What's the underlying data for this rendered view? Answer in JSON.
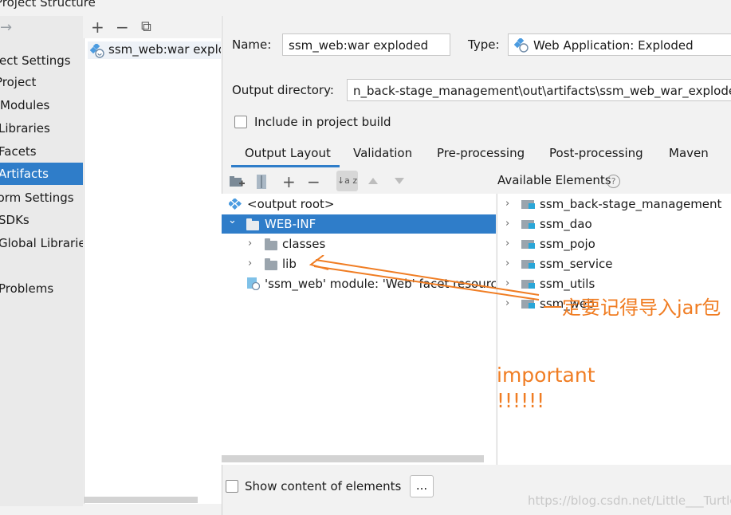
{
  "window": {
    "title": "Project Structure"
  },
  "nav": {
    "back_arrow": "→",
    "items": [
      {
        "label": "Project Settings",
        "selected": false
      },
      {
        "label": "Project",
        "selected": false
      },
      {
        "label": "Modules",
        "selected": false
      },
      {
        "label": "Libraries",
        "selected": false
      },
      {
        "label": "Facets",
        "selected": false
      },
      {
        "label": "Artifacts",
        "selected": true
      },
      {
        "label": "Platform Settings",
        "selected": false
      },
      {
        "label": "SDKs",
        "selected": false
      },
      {
        "label": "Global Libraries",
        "selected": false
      },
      {
        "label": "Problems",
        "selected": false
      }
    ]
  },
  "artifacts_toolbar": {
    "add": "+",
    "remove": "−",
    "copy": "⧉"
  },
  "artifacts": [
    {
      "label": "ssm_web:war exploded",
      "icon": "web-artifact-icon"
    }
  ],
  "form": {
    "name_label": "Name:",
    "name_value": "ssm_web:war exploded",
    "type_label": "Type:",
    "type_value": "Web Application: Exploded",
    "output_label": "Output directory:",
    "output_value": "n_back-stage_management\\out\\artifacts\\ssm_web_war_exploded",
    "include_label": "Include in project build",
    "include_checked": false
  },
  "tabs": [
    {
      "label": "Output Layout",
      "active": true
    },
    {
      "label": "Validation",
      "active": false
    },
    {
      "label": "Pre-processing",
      "active": false
    },
    {
      "label": "Post-processing",
      "active": false
    },
    {
      "label": "Maven",
      "active": false
    }
  ],
  "layout_toolbar": {
    "add": "+",
    "remove": "−",
    "sort": "↓a z"
  },
  "available_title": "Available Elements",
  "help_glyph": "?",
  "layout_tree": [
    {
      "label": "<output root>",
      "chevron": "",
      "selected": false
    },
    {
      "label": "WEB-INF",
      "chevron": "⌄",
      "selected": true
    },
    {
      "label": "classes",
      "chevron": "›",
      "selected": false
    },
    {
      "label": "lib",
      "chevron": "›",
      "selected": false
    },
    {
      "label": "'ssm_web' module: 'Web' facet resources",
      "chevron": "",
      "selected": false
    }
  ],
  "available": [
    {
      "label": "ssm_back-stage_management"
    },
    {
      "label": "ssm_dao"
    },
    {
      "label": "ssm_pojo"
    },
    {
      "label": "ssm_service"
    },
    {
      "label": "ssm_utils"
    },
    {
      "label": "ssm_web"
    }
  ],
  "bottom": {
    "show_content_label": "Show content of elements",
    "more_button": "..."
  },
  "annotations": {
    "jar_note": "一定要记得导入jar包",
    "important": "important",
    "bangs": "!!!!!!",
    "color": "#f07d23"
  },
  "watermark": "https://blog.csdn.net/Little___Turtle"
}
